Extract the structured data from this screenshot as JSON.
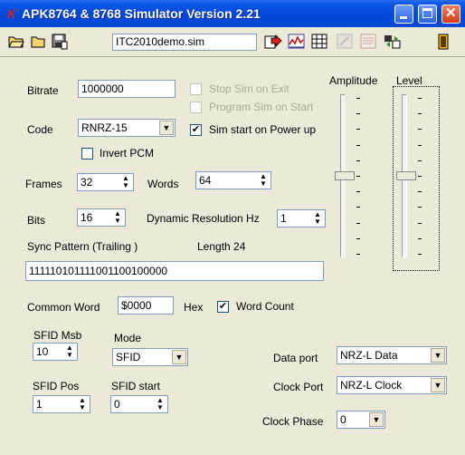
{
  "window": {
    "logo": "K",
    "title": "APK8764 & 8768 Simulator Version 2.21"
  },
  "toolbar": {
    "file_name": "ITC2010demo.sim",
    "icons": [
      "open-folder-icon",
      "folder-icon",
      "save-disk-icon",
      "load-arrow-icon",
      "waveform-icon",
      "grid-icon",
      "edit-disabled-icon",
      "table-disabled-icon",
      "swap-icon",
      "exit-door-icon"
    ]
  },
  "bitrate": {
    "label": "Bitrate",
    "value": "1000000"
  },
  "options": {
    "stop_sim_on_exit": {
      "label": "Stop Sim on Exit",
      "checked": false,
      "enabled": false
    },
    "program_sim_on_start": {
      "label": "Program Sim on Start",
      "checked": false,
      "enabled": false
    },
    "sim_start_on_power_up": {
      "label": "Sim start on Power up",
      "checked": true,
      "enabled": true
    }
  },
  "code": {
    "label": "Code",
    "value": "RNRZ-15"
  },
  "invert_pcm": {
    "label": "Invert PCM",
    "checked": false
  },
  "frames": {
    "label": "Frames",
    "value": "32"
  },
  "words": {
    "label": "Words",
    "value": "64"
  },
  "bits": {
    "label": "Bits",
    "value": "16"
  },
  "dyn_res": {
    "label": "Dynamic Resolution Hz",
    "value": "1"
  },
  "sync": {
    "label": "Sync Pattern (Trailing )",
    "length_label": "Length 24",
    "value": "111110101111001100100000"
  },
  "amplitude": {
    "label": "Amplitude",
    "level": 0.5
  },
  "level": {
    "label": "Level",
    "level": 0.5
  },
  "common_word": {
    "label": "Common Word",
    "value": "$0000",
    "hex_label": "Hex"
  },
  "word_count": {
    "label": "Word Count",
    "checked": true
  },
  "sfid_msb": {
    "label": "SFID Msb",
    "value": "10"
  },
  "mode": {
    "label": "Mode",
    "value": "SFID"
  },
  "sfid_pos": {
    "label": "SFID Pos",
    "value": "1"
  },
  "sfid_start": {
    "label": "SFID start",
    "value": "0"
  },
  "data_port": {
    "label": "Data port",
    "value": "NRZ-L Data"
  },
  "clock_port": {
    "label": "Clock Port",
    "value": "NRZ-L Clock"
  },
  "clock_phase": {
    "label": "Clock Phase",
    "value": "0"
  }
}
